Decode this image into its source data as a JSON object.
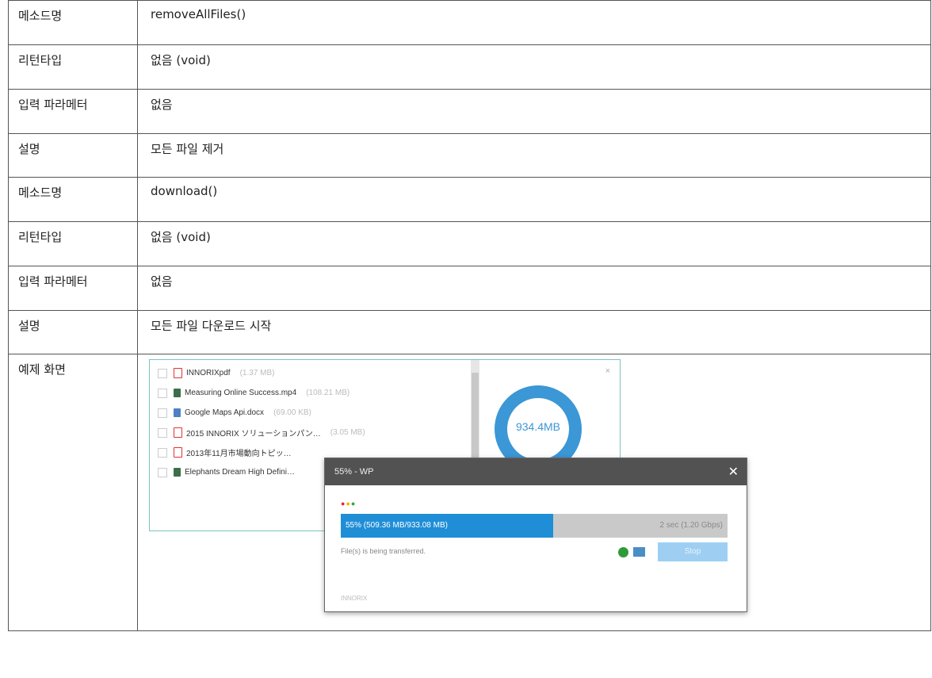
{
  "rows": [
    {
      "label": "메소드명",
      "value": "removeAllFiles()"
    },
    {
      "label": "리턴타입",
      "value": "없음 (void)"
    },
    {
      "label": "입력 파라메터",
      "value": "없음"
    },
    {
      "label": "설명",
      "value": "모든 파일 제거"
    },
    {
      "label": "메소드명",
      "value": "download()"
    },
    {
      "label": "리턴타입",
      "value": "없음 (void)"
    },
    {
      "label": "입력 파라메터",
      "value": "없음"
    },
    {
      "label": "설명",
      "value": "모든 파일 다운로드 시작"
    }
  ],
  "example_label": "예제 화면",
  "screenshot": {
    "files": [
      {
        "name": "INNORIXpdf",
        "size": "(1.37 MB)",
        "icon": "pdf-icon"
      },
      {
        "name": "Measuring Online Success.mp4",
        "size": "(108.21 MB)",
        "icon": "video-icon"
      },
      {
        "name": "Google Maps Api.docx",
        "size": "(69.00 KB)",
        "icon": "doc-icon"
      },
      {
        "name": "2015 INNORIX ソリューションパン…",
        "size": "(3.05 MB)",
        "icon": "pdf-icon"
      },
      {
        "name": "2013年11月市場動向トピッ…",
        "size": "",
        "icon": "pdf-icon"
      },
      {
        "name": "Elephants Dream High Defini…",
        "size": "",
        "icon": "video-icon"
      }
    ],
    "total_size": "934.4MB",
    "window_close": "×",
    "dialog": {
      "title": "55% - WP",
      "close": "✕",
      "progress_percent": 55,
      "progress_text": "55% (509.36 MB/933.08 MB)",
      "rate_text": "2 sec (1.20 Gbps)",
      "message": "File(s) is being transferred.",
      "stop_label": "Stop",
      "brand": "INNORIX"
    },
    "colors": {
      "accent": "#1f8ed6",
      "ring": "#3b97d6"
    }
  }
}
